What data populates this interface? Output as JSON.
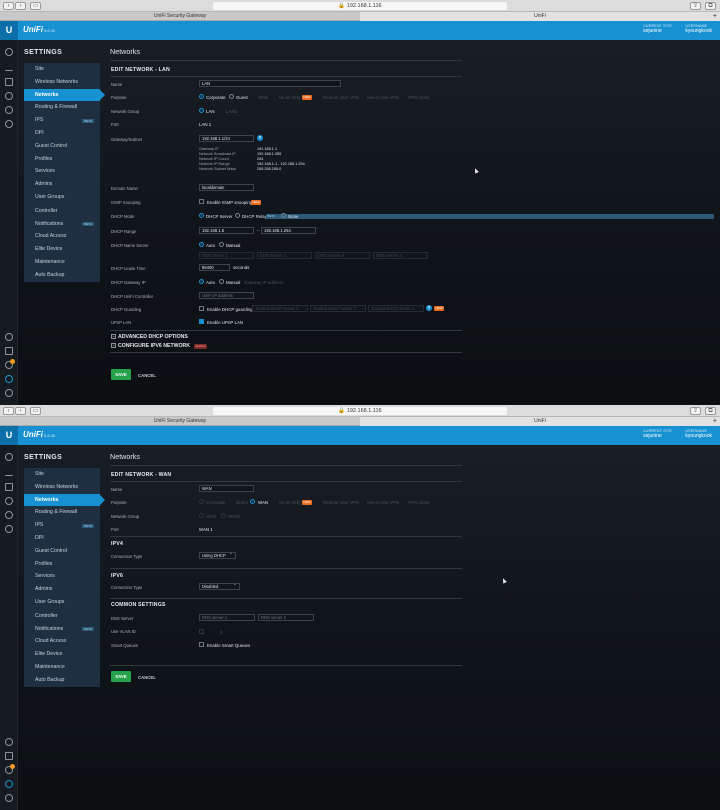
{
  "browser": {
    "url": "192.168.1.116",
    "tabs": [
      "UniFi Security Gateway",
      "UniFi"
    ],
    "new_tab": "+"
  },
  "app": {
    "brand": "UniFi",
    "version": "5.6.30",
    "current_site_label": "CURRENT SITE",
    "current_site": "sejunine",
    "username_label": "USERNAME",
    "username": "kyoungkook",
    "accent_color": "#1791d1"
  },
  "sidebar": {
    "title": "SETTINGS",
    "items": [
      {
        "label": "Site"
      },
      {
        "label": "Wireless Networks"
      },
      {
        "label": "Networks"
      },
      {
        "label": "Routing & Firewall"
      },
      {
        "label": "IPS",
        "badge": "BETA"
      },
      {
        "label": "DPI"
      },
      {
        "label": "Guest Control"
      },
      {
        "label": "Profiles"
      },
      {
        "label": "Services"
      },
      {
        "label": "Admins"
      },
      {
        "label": "User Groups"
      },
      {
        "label": "Controller"
      },
      {
        "label": "Notifications",
        "badge": "BETA"
      },
      {
        "label": "Cloud Access"
      },
      {
        "label": "Elite Device"
      },
      {
        "label": "Maintenance"
      },
      {
        "label": "Auto Backup"
      }
    ],
    "active": "Networks"
  },
  "lan": {
    "page_title": "Networks",
    "section": "EDIT NETWORK - LAN",
    "name_label": "Name",
    "name_value": "LAN",
    "purpose_label": "Purpose",
    "purpose_options": [
      "Corporate",
      "Guest",
      "WAN",
      "VLAN Only",
      "Remote User VPN",
      "Site-to-Site VPN",
      "VPN Client"
    ],
    "vlan_only_badge": "NEW",
    "network_group_label": "Network Group",
    "network_group_options": [
      "LAN",
      "LAN2"
    ],
    "port_label": "Port",
    "port_value": "LAN 1",
    "gateway_label": "Gateway/Subnet",
    "gateway_value": "192.168.1.1/24",
    "help": "?",
    "info": [
      {
        "k": "Gateway IP",
        "v": "192.168.1.1"
      },
      {
        "k": "Network Broadcast IP",
        "v": "192.168.1.255"
      },
      {
        "k": "Network IP Count",
        "v": "254"
      },
      {
        "k": "Network IP Range",
        "v": "192.168.1.1 - 192.168.1.254"
      },
      {
        "k": "Network Subnet Mask",
        "v": "255.255.255.0"
      }
    ],
    "domain_label": "Domain Name",
    "domain_value": "localdomain",
    "igmp_label": "IGMP Snooping",
    "igmp_option": "Enable IGMP snooping",
    "igmp_badge": "NEW",
    "dhcp_mode_label": "DHCP Mode",
    "dhcp_mode_options": [
      "DHCP Server",
      "DHCP Relay",
      "None"
    ],
    "dhcp_relay_badge": "BETA",
    "dhcp_range_label": "DHCP Range",
    "dhcp_range_start": "192.168.1.6",
    "dhcp_range_sep": "-",
    "dhcp_range_end": "192.168.1.254",
    "dns_label": "DHCP Name Server",
    "dns_options": [
      "Auto",
      "Manual"
    ],
    "dns_servers": [
      "DNS Server 1",
      "DNS Server 2",
      "DNS Server 3",
      "DNS Server 4"
    ],
    "lease_label": "DHCP Lease Time",
    "lease_value": "86400",
    "lease_unit": "seconds",
    "gw_ip_label": "DHCP Gateway IP",
    "gw_ip_options": [
      "Auto",
      "Manual"
    ],
    "gw_ip_placeholder": "Gateway IP address",
    "unifi_ctrl_label": "DHCP UniFi Controller",
    "unifi_ctrl_placeholder": "UniFi IP address",
    "guarding_label": "DHCP Guarding",
    "guarding_option": "Enable DHCP guarding",
    "guarding_servers": [
      "Trusted DHCP server 1",
      "Trusted DHCP server 2",
      "Trusted DHCP server 3"
    ],
    "guarding_badge": "NEW",
    "upnp_label": "UPnP LAN",
    "upnp_option": "Enable UPnP LAN",
    "advanced_dhcp": "ADVANCED DHCP OPTIONS",
    "ipv6": "CONFIGURE IPV6 NETWORK",
    "ipv6_badge": "ALPHA",
    "save": "SAVE",
    "cancel": "CANCEL"
  },
  "wan": {
    "page_title": "Networks",
    "section": "EDIT NETWORK - WAN",
    "name_label": "Name",
    "name_value": "WAN",
    "purpose_label": "Purpose",
    "purpose_options": [
      "Corporate",
      "Guest",
      "WAN",
      "VLAN Only",
      "Remote User VPN",
      "Site-to-Site VPN",
      "VPN Client"
    ],
    "vlan_only_badge": "NEW",
    "network_group_label": "Network Group",
    "network_group_options": [
      "WAN",
      "WAN2"
    ],
    "port_label": "Port",
    "port_value": "WAN 1",
    "ipv4_section": "IPV4",
    "conn_type_label": "Connection Type",
    "ipv4_conn_type": "Using DHCP",
    "ipv6_section": "IPV6",
    "ipv6_conn_type": "Disabled",
    "common_section": "COMMON SETTINGS",
    "dns_label": "DNS Server",
    "dns_servers": [
      "DNS server 1",
      "DNS server 2"
    ],
    "vlan_label": "Use VLAN ID",
    "vlan_value": "2",
    "queues_label": "Smart Queues",
    "queues_option": "Enable Smart Queues",
    "save": "SAVE",
    "cancel": "CANCEL"
  }
}
